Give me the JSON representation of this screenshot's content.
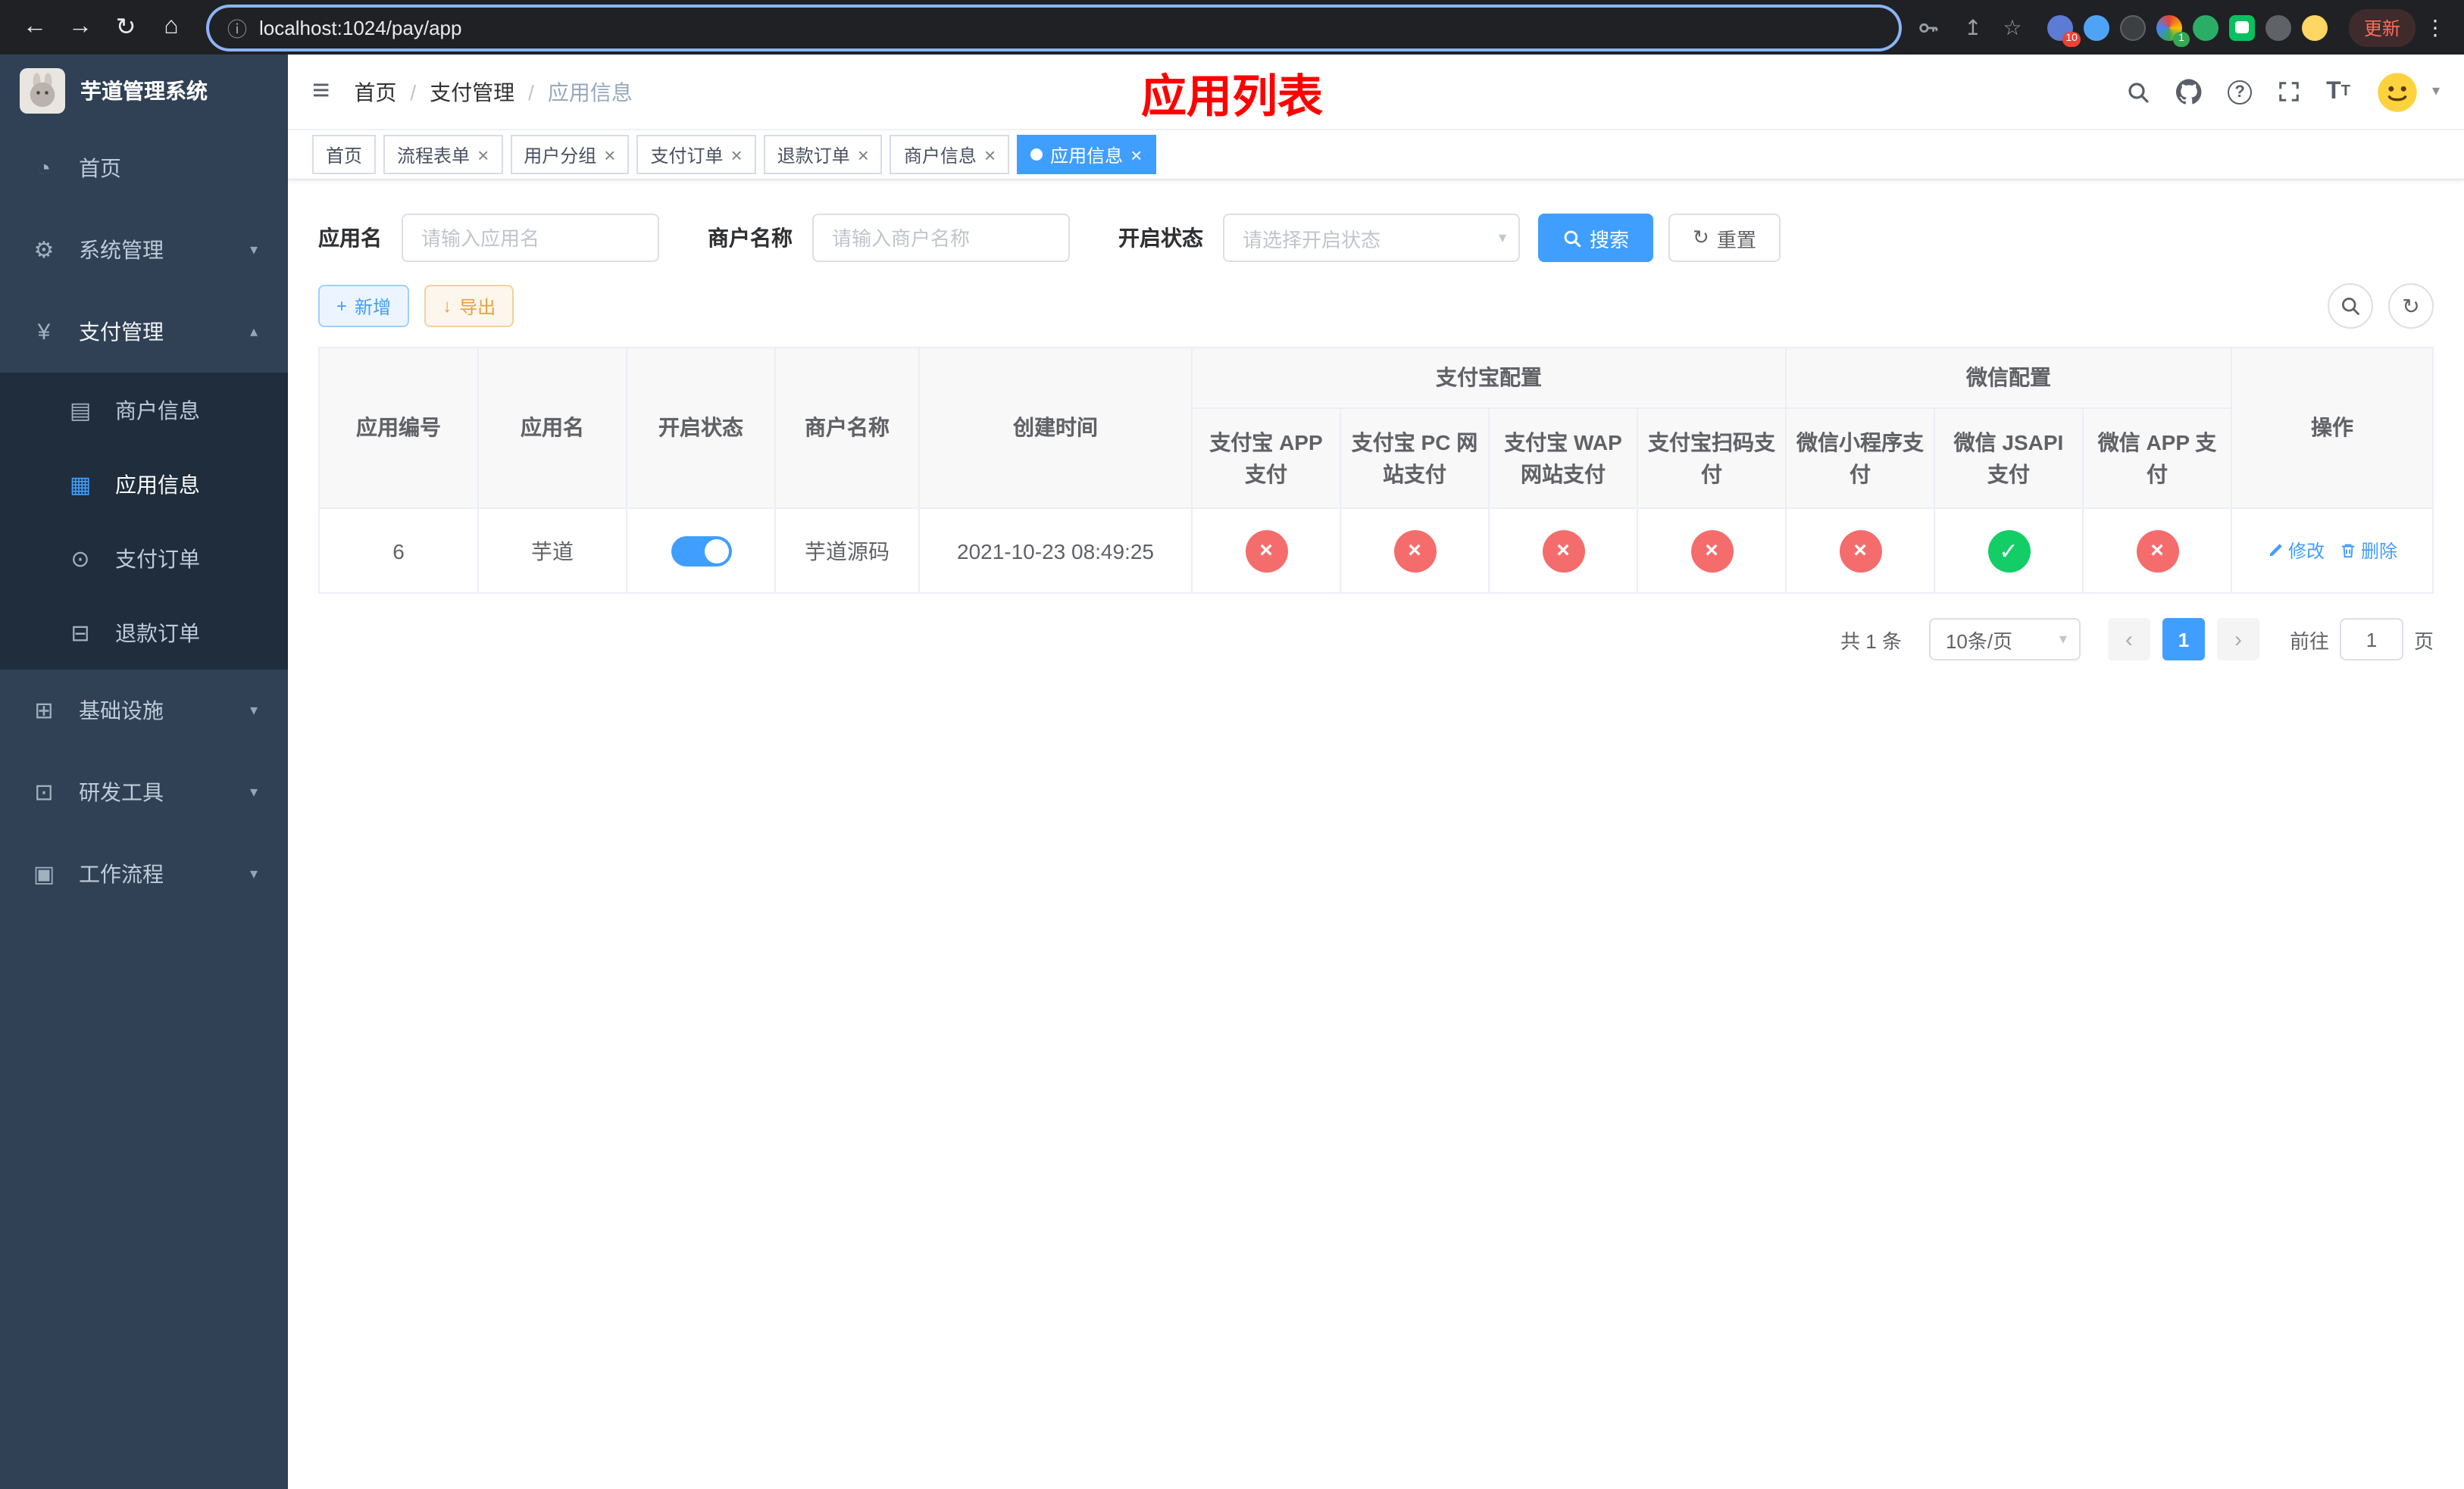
{
  "browser": {
    "url": "localhost:1024/pay/app",
    "update_label": "更新",
    "ext_badges": {
      "extensions": "10",
      "profile": "1"
    }
  },
  "icons": {
    "back": "←",
    "forward": "→",
    "reload": "↻",
    "home": "⌂",
    "info": "ⓘ",
    "share": "↥",
    "star": "☆",
    "kebab": "⋮",
    "hamburger": "≡",
    "slash": "/",
    "help": "?",
    "caret": "▾",
    "dashboard": "◔",
    "gear": "⚙",
    "yen": "¥",
    "card": "▤",
    "grid": "▦",
    "order": "⊙",
    "refund": "⊟",
    "infra": "⊞",
    "tools": "⊡",
    "flow": "▣",
    "chev_down": "▾",
    "chev_up": "▴",
    "plus": "+",
    "download": "↓",
    "refresh": "↻",
    "check": "✓",
    "cross": "×",
    "close": "×",
    "dot": "●",
    "prev": "‹",
    "next": "›",
    "font_big": "T",
    "font_small": "T"
  },
  "sidebar": {
    "title": "芋道管理系统",
    "home": "首页",
    "system": "系统管理",
    "payment": "支付管理",
    "merchant_info": "商户信息",
    "app_info": "应用信息",
    "pay_order": "支付订单",
    "refund_order": "退款订单",
    "infra": "基础设施",
    "dev_tools": "研发工具",
    "workflow": "工作流程"
  },
  "header": {
    "breadcrumb": {
      "home": "首页",
      "payment": "支付管理",
      "app_info": "应用信息"
    },
    "page_title": "应用列表"
  },
  "tabs": [
    {
      "label": "首页"
    },
    {
      "label": "流程表单"
    },
    {
      "label": "用户分组"
    },
    {
      "label": "支付订单"
    },
    {
      "label": "退款订单"
    },
    {
      "label": "商户信息"
    },
    {
      "label": "应用信息"
    }
  ],
  "filters": {
    "app_name_label": "应用名",
    "app_name_placeholder": "请输入应用名",
    "merchant_label": "商户名称",
    "merchant_placeholder": "请输入商户名称",
    "status_label": "开启状态",
    "status_placeholder": "请选择开启状态",
    "search_label": "搜索",
    "reset_label": "重置"
  },
  "toolbar": {
    "add_label": "新增",
    "export_label": "导出"
  },
  "table": {
    "groups": {
      "alipay": "支付宝配置",
      "wechat": "微信配置"
    },
    "columns": {
      "id": "应用编号",
      "name": "应用名",
      "status": "开启状态",
      "merchant": "商户名称",
      "created": "创建时间",
      "alipay_app": "支付宝 APP 支付",
      "alipay_pc": "支付宝 PC 网站支付",
      "alipay_wap": "支付宝 WAP 网站支付",
      "alipay_qr": "支付宝扫码支付",
      "wx_mini": "微信小程序支付",
      "wx_jsapi": "微信 JSAPI 支付",
      "wx_app": "微信 APP 支付",
      "actions": "操作"
    },
    "rows": [
      {
        "id": "6",
        "name": "芋道",
        "status_on": true,
        "merchant": "芋道源码",
        "created": "2021-10-23 08:49:25",
        "channels": [
          "no",
          "no",
          "no",
          "no",
          "no",
          "yes",
          "no"
        ],
        "edit_label": "修改",
        "delete_label": "删除"
      }
    ]
  },
  "pagination": {
    "total_text": "共 1 条",
    "page_size": "10条/页",
    "current_page": "1",
    "goto_label": "前往",
    "goto_value": "1",
    "page_unit": "页"
  }
}
